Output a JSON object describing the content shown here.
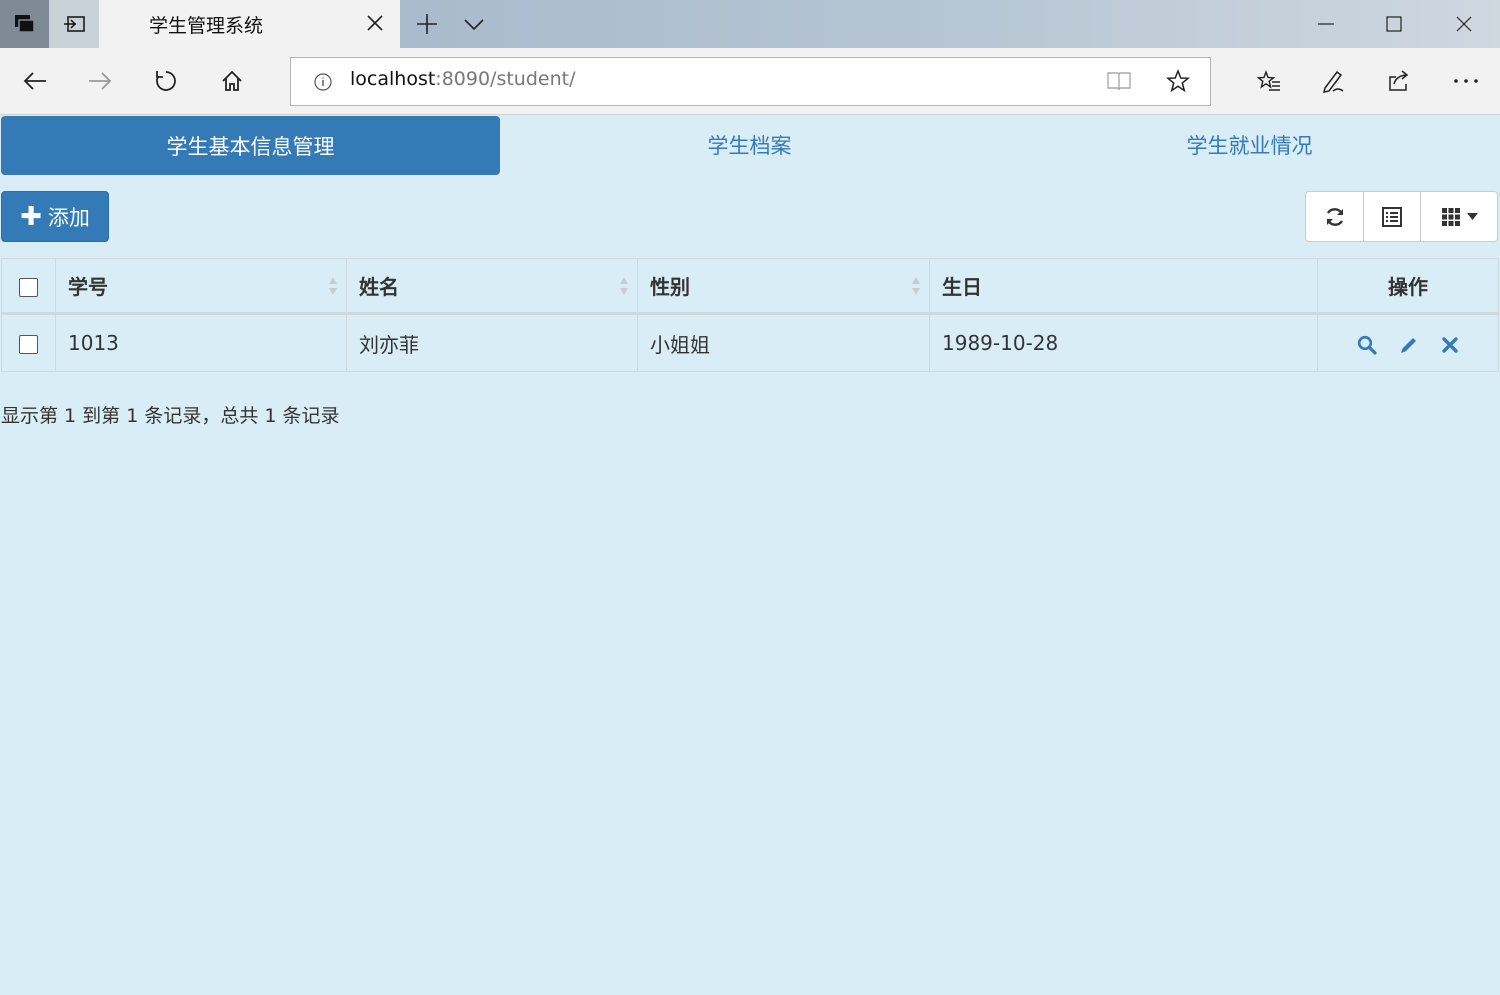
{
  "browser": {
    "tab_title": "学生管理系统",
    "url_host": "localhost",
    "url_path": ":8090/student/"
  },
  "page": {
    "tabs": [
      {
        "label": "学生基本信息管理",
        "active": true
      },
      {
        "label": "学生档案",
        "active": false
      },
      {
        "label": "学生就业情况",
        "active": false
      }
    ],
    "add_button": "添加",
    "table": {
      "headers": [
        "学号",
        "姓名",
        "性别",
        "生日",
        "操作"
      ],
      "rows": [
        {
          "id": "1013",
          "name": "刘亦菲",
          "gender": "小姐姐",
          "birthday": "1989-10-28"
        }
      ]
    },
    "pagination_text": "显示第 1 到第 1 条记录，总共 1 条记录"
  },
  "colors": {
    "primary": "#337ab7",
    "background": "#d9edf7",
    "gender_highlight": "#e4101a"
  }
}
